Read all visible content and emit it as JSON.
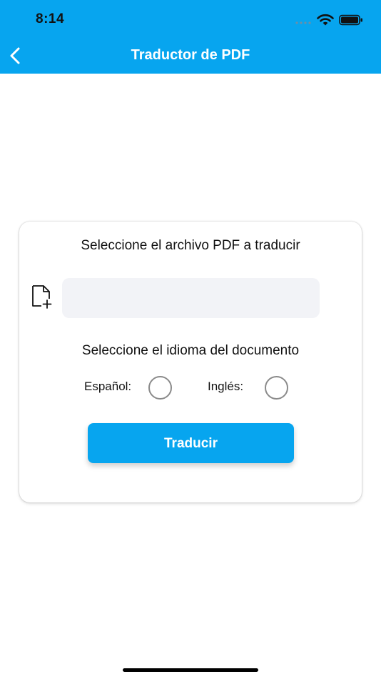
{
  "status_bar": {
    "time": "8:14"
  },
  "nav": {
    "title": "Traductor de PDF",
    "back_icon": "chevron-left-icon"
  },
  "form": {
    "file_prompt": "Seleccione el archivo PDF a traducir",
    "file_icon": "file-add-icon",
    "file_field_value": "",
    "language_prompt": "Seleccione el idioma del documento",
    "language_options": [
      {
        "label": "Español:",
        "selected": false
      },
      {
        "label": "Inglés:",
        "selected": false
      }
    ],
    "submit_label": "Traducir"
  },
  "colors": {
    "accent": "#07a5ef",
    "field_background": "#f2f3f7",
    "radio_border": "#8a8a8a"
  }
}
